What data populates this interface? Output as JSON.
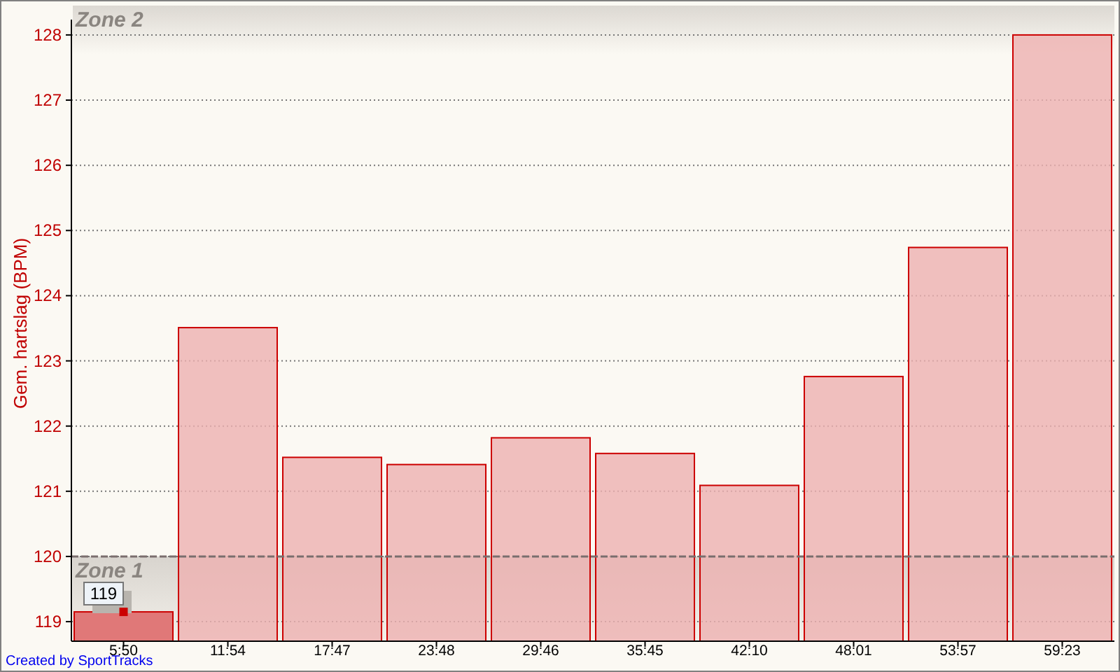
{
  "chart_data": {
    "type": "bar",
    "ylabel": "Gem. hartslag (BPM)",
    "categories": [
      "5:50",
      "11:54",
      "17:47",
      "23:48",
      "29:46",
      "35:45",
      "42:10",
      "48:01",
      "53:57",
      "59:23"
    ],
    "series": [
      {
        "color": "#cc0000",
        "values": [
          119.15,
          123.51,
          121.52,
          121.41,
          121.82,
          121.58,
          121.09,
          122.76,
          124.74,
          128.0
        ]
      }
    ],
    "ylim": [
      118.7,
      128.45
    ],
    "yticks": [
      119,
      120,
      121,
      122,
      123,
      124,
      125,
      126,
      127,
      128
    ],
    "grid": true,
    "bands": [
      {
        "label": "Zone 2",
        "from": 127.7,
        "to": 128.45,
        "axis": "y"
      },
      {
        "label": "Zone 1",
        "from": 118.7,
        "to": 120,
        "axis": "y"
      }
    ],
    "ref_lines": [
      {
        "value": 120,
        "axis": "y"
      }
    ]
  },
  "bar_states": [
    {
      "selected": true
    },
    {
      "selected": false
    },
    {
      "selected": false
    },
    {
      "selected": false
    },
    {
      "selected": false
    },
    {
      "selected": false
    },
    {
      "selected": false
    },
    {
      "selected": false
    },
    {
      "selected": false
    },
    {
      "selected": false
    }
  ],
  "tooltip": {
    "text": "119"
  },
  "credit": "Created by SportTracks"
}
